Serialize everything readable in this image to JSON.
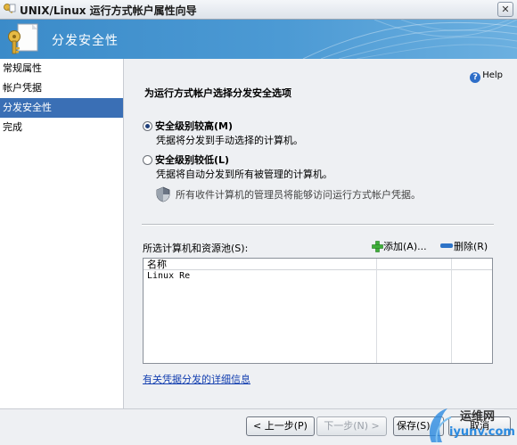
{
  "window": {
    "title": "UNIX/Linux 运行方式帐户属性向导",
    "close_glyph": "✕"
  },
  "header": {
    "title": "分发安全性"
  },
  "nav": {
    "items": [
      {
        "label": "常规属性"
      },
      {
        "label": "帐户凭据"
      },
      {
        "label": "分发安全性",
        "active": true
      },
      {
        "label": "完成"
      }
    ]
  },
  "main": {
    "help_label": "Help",
    "heading": "为运行方式帐户选择分发安全选项",
    "options": [
      {
        "label": "安全级别较高(M)",
        "description": "凭据将分发到手动选择的计算机。",
        "selected": true
      },
      {
        "label": "安全级别较低(L)",
        "description": "凭据将自动分发到所有被管理的计算机。",
        "selected": false
      }
    ],
    "note": "所有收件计算机的管理员将能够访问运行方式帐户凭据。",
    "selection_label": "所选计算机和资源池(S):",
    "add_label": "添加(A)...",
    "remove_label": "删除(R)",
    "list": {
      "columns": [
        "名称"
      ],
      "rows": [
        "Linux Re"
      ]
    },
    "details_link": "有关凭据分发的详细信息"
  },
  "buttons": {
    "back": "< 上一步(P)",
    "next": "下一步(N) >",
    "save": "保存(S)",
    "cancel": "取消"
  },
  "watermark": {
    "line1": "运维网",
    "line2": "iyunv.com"
  },
  "colors": {
    "header_blue": "#4c9ad4",
    "nav_active": "#3a6fb5",
    "link": "#1540b0",
    "panel": "#eef0f3"
  }
}
